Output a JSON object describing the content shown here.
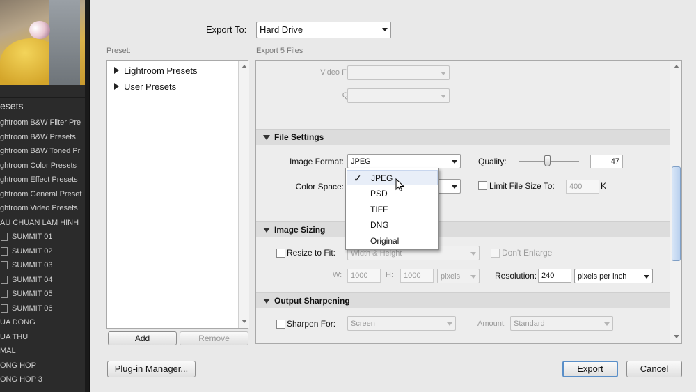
{
  "left_panel": {
    "section_title": "esets",
    "items": [
      {
        "label": "ghtroom B&W Filter Pre"
      },
      {
        "label": "ghtroom B&W Presets"
      },
      {
        "label": "ghtroom B&W Toned Pr"
      },
      {
        "label": "ghtroom Color Presets"
      },
      {
        "label": "ghtroom Effect Presets"
      },
      {
        "label": "ghtroom General Preset"
      },
      {
        "label": "ghtroom Video Presets"
      },
      {
        "label": "AU CHUAN LAM HINH"
      },
      {
        "label": "SUMMIT 01"
      },
      {
        "label": "SUMMIT 02"
      },
      {
        "label": "SUMMIT 03"
      },
      {
        "label": "SUMMIT 04"
      },
      {
        "label": "SUMMIT 05"
      },
      {
        "label": "SUMMIT 06"
      },
      {
        "label": "UA DONG"
      },
      {
        "label": "UA THU"
      },
      {
        "label": "MAL"
      },
      {
        "label": "ONG HOP"
      },
      {
        "label": "ONG HOP 3"
      }
    ]
  },
  "export_to": {
    "label": "Export To:",
    "value": "Hard Drive"
  },
  "preset": {
    "label": "Preset:",
    "tree": [
      "Lightroom Presets",
      "User Presets"
    ],
    "add_label": "Add",
    "remove_label": "Remove"
  },
  "export_count": "Export 5 Files",
  "video": {
    "format_label": "Video Format:",
    "quality_label": "Quality:"
  },
  "file_settings": {
    "title": "File Settings",
    "image_format_label": "Image Format:",
    "image_format_value": "JPEG",
    "quality_label": "Quality:",
    "quality_value": "47",
    "quality_fraction": 0.47,
    "color_space_label": "Color Space:",
    "limit_label": "Limit File Size To:",
    "limit_value": "400",
    "limit_unit": "K",
    "format_options": [
      "JPEG",
      "PSD",
      "TIFF",
      "DNG",
      "Original"
    ],
    "selected_option": "JPEG"
  },
  "image_sizing": {
    "title": "Image Sizing",
    "resize_label": "Resize to Fit:",
    "resize_value": "Width & Height",
    "dont_enlarge_label": "Don't Enlarge",
    "w_label": "W:",
    "w_value": "1000",
    "h_label": "H:",
    "h_value": "1000",
    "units_value": "pixels",
    "resolution_label": "Resolution:",
    "resolution_value": "240",
    "resolution_units": "pixels per inch"
  },
  "output_sharpening": {
    "title": "Output Sharpening",
    "sharpen_label": "Sharpen For:",
    "sharpen_value": "Screen",
    "amount_label": "Amount:",
    "amount_value": "Standard"
  },
  "footer": {
    "plugin_label": "Plug-in Manager...",
    "export_label": "Export",
    "cancel_label": "Cancel"
  }
}
